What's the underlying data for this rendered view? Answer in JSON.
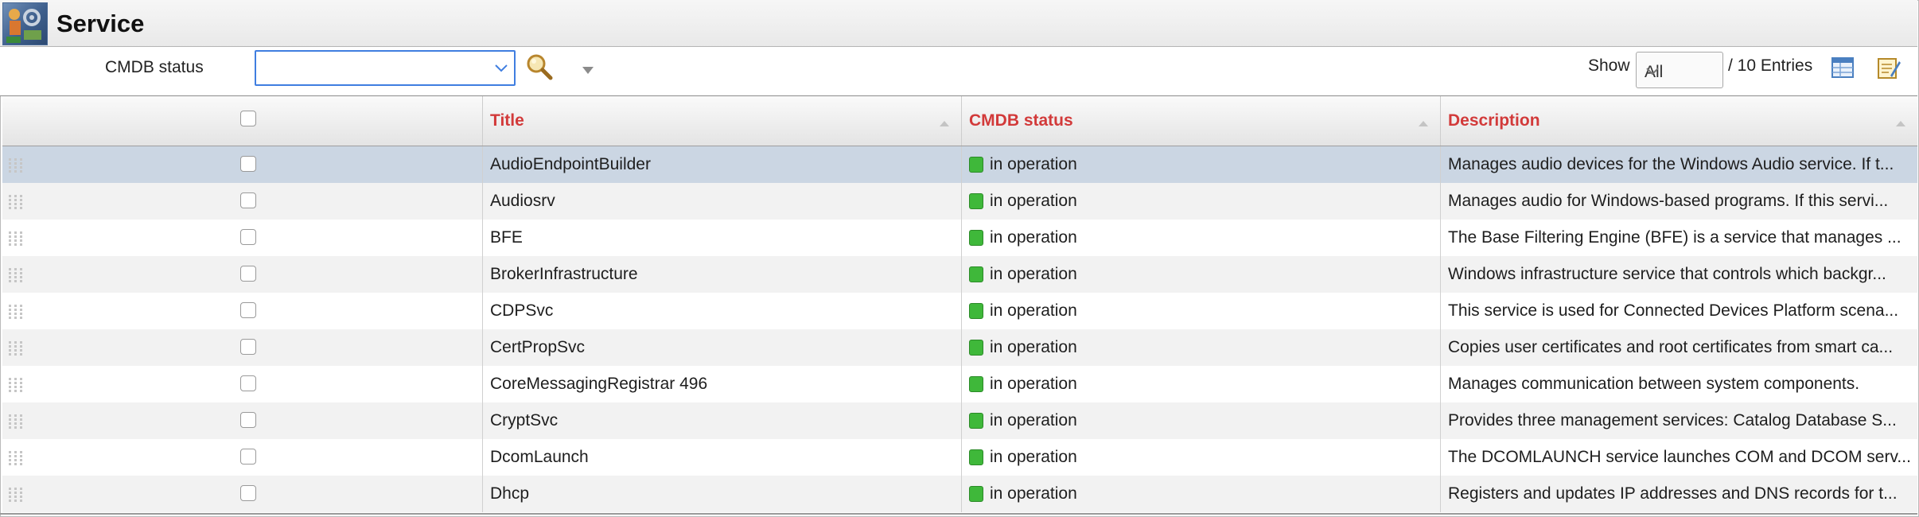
{
  "header": {
    "title": "Service",
    "logo_icon": "service-app-logo"
  },
  "filter": {
    "label": "CMDB status",
    "value": "",
    "search_icon": "magnifier-icon",
    "more_icon": "triangle-down-icon"
  },
  "pagination": {
    "show_label": "Show",
    "show_value": "All",
    "entries_text": "/ 10 Entries",
    "icons": [
      "table-view-icon",
      "edit-list-icon"
    ]
  },
  "table": {
    "columns": [
      {
        "key": "title",
        "label": "Title"
      },
      {
        "key": "status",
        "label": "CMDB status"
      },
      {
        "key": "description",
        "label": "Description"
      }
    ],
    "header_color": "#d23a3a",
    "status_color": "#3fb83a",
    "rows": [
      {
        "title": "AudioEndpointBuilder",
        "status": "in operation",
        "description": "Manages audio devices for the Windows Audio service. If t...",
        "selected": true
      },
      {
        "title": "Audiosrv",
        "status": "in operation",
        "description": "Manages audio for Windows-based programs. If this servi..."
      },
      {
        "title": "BFE",
        "status": "in operation",
        "description": "The Base Filtering Engine (BFE) is a service that manages ..."
      },
      {
        "title": "BrokerInfrastructure",
        "status": "in operation",
        "description": "Windows infrastructure service that controls which backgr..."
      },
      {
        "title": "CDPSvc",
        "status": "in operation",
        "description": "This service is used for Connected Devices Platform scena..."
      },
      {
        "title": "CertPropSvc",
        "status": "in operation",
        "description": "Copies user certificates and root certificates from smart ca..."
      },
      {
        "title": "CoreMessagingRegistrar 496",
        "status": "in operation",
        "description": "Manages communication between system components."
      },
      {
        "title": "CryptSvc",
        "status": "in operation",
        "description": "Provides three management services: Catalog Database S..."
      },
      {
        "title": "DcomLaunch",
        "status": "in operation",
        "description": "The DCOMLAUNCH service launches COM and DCOM serv..."
      },
      {
        "title": "Dhcp",
        "status": "in operation",
        "description": "Registers and updates IP addresses and DNS records for t..."
      }
    ]
  }
}
